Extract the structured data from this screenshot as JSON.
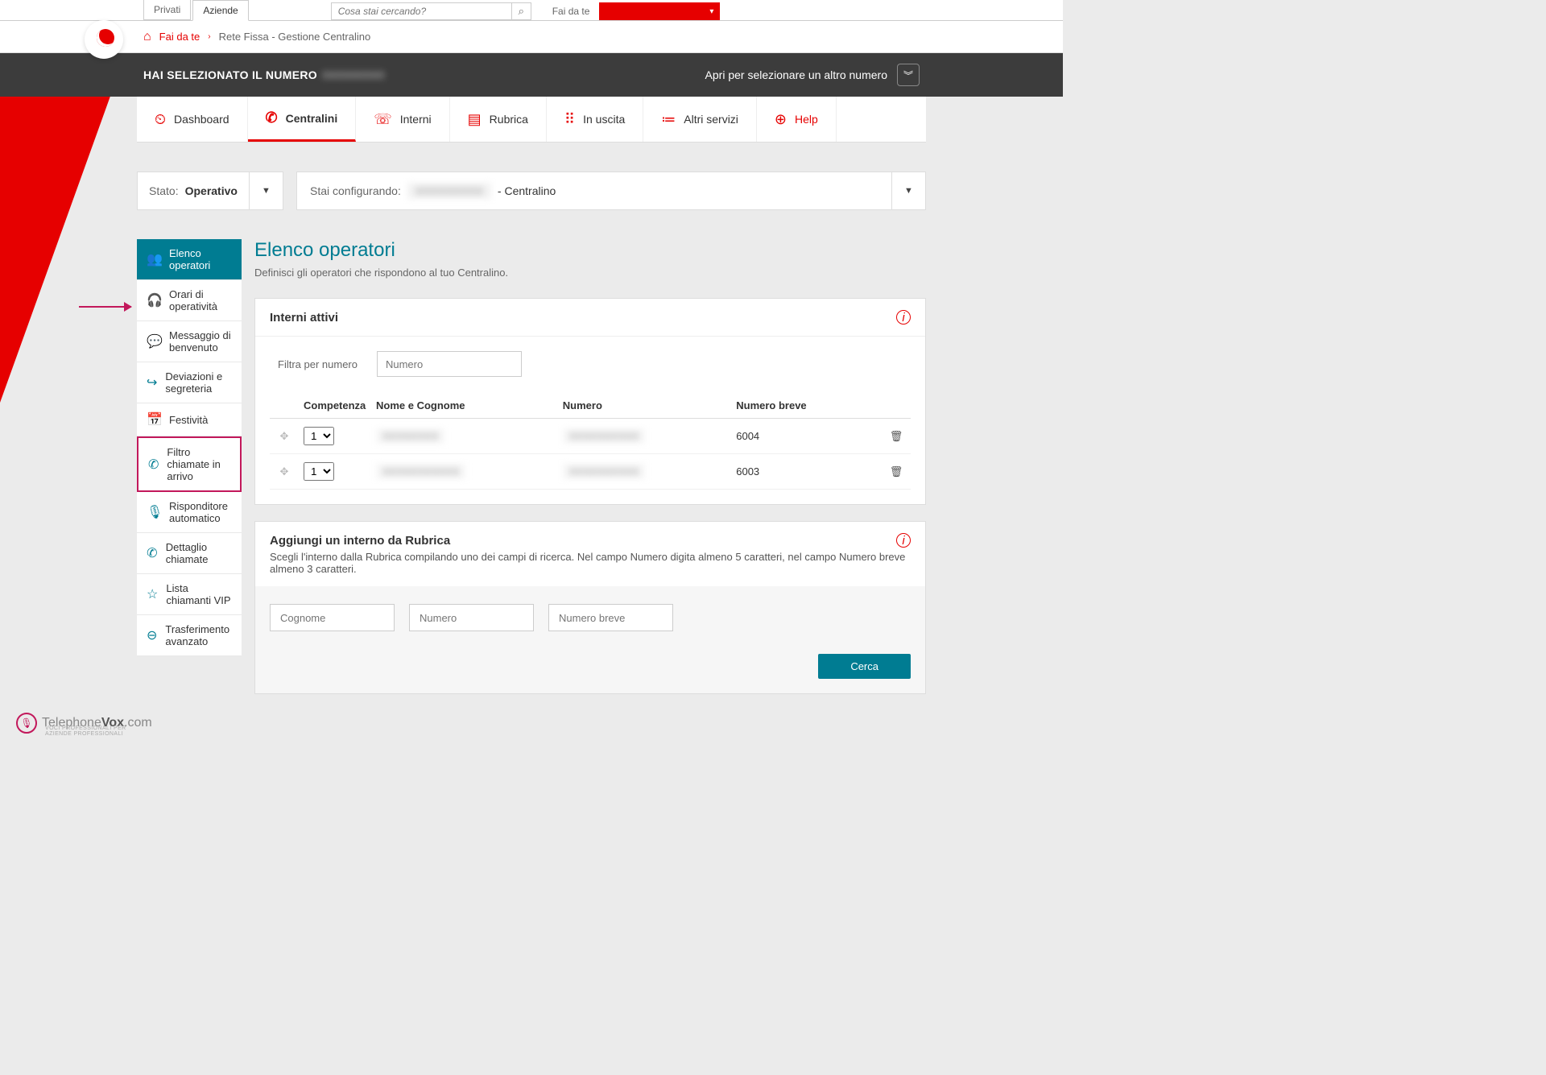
{
  "top": {
    "tab_privati": "Privati",
    "tab_aziende": "Aziende",
    "search_placeholder": "Cosa stai cercando?",
    "faidate_label": "Fai da te"
  },
  "breadcrumb": {
    "home_text": "Fai da te",
    "current": "Rete Fissa - Gestione Centralino"
  },
  "darkbar": {
    "label": "HAI SELEZIONATO IL NUMERO",
    "blur_number": "0000000000",
    "open_label": "Apri per selezionare un altro numero"
  },
  "nav": {
    "dashboard": "Dashboard",
    "centralini": "Centralini",
    "interni": "Interni",
    "rubrica": "Rubrica",
    "uscita": "In uscita",
    "altri": "Altri servizi",
    "help": "Help"
  },
  "status": {
    "stato": "Stato:",
    "op": "Operativo",
    "config_label": "Stai configurando:",
    "config_blur": "XXXXXXXXX",
    "config_suffix": "- Centralino"
  },
  "sidebar": {
    "items": [
      {
        "label": "Elenco operatori"
      },
      {
        "label": "Orari di operatività"
      },
      {
        "label": "Messaggio di benvenuto"
      },
      {
        "label": "Deviazioni e segreteria"
      },
      {
        "label": "Festività"
      },
      {
        "label": "Filtro chiamate in arrivo"
      },
      {
        "label": "Risponditore automatico"
      },
      {
        "label": "Dettaglio chiamate"
      },
      {
        "label": "Lista chiamanti VIP"
      },
      {
        "label": "Trasferimento avanzato"
      }
    ]
  },
  "main": {
    "title": "Elenco operatori",
    "subtitle": "Definisci gli operatori che rispondono al tuo Centralino."
  },
  "interni": {
    "head": "Interni attivi",
    "filter_label": "Filtra per numero",
    "filter_placeholder": "Numero",
    "cols": {
      "comp": "Competenza",
      "nome": "Nome e Cognome",
      "numero": "Numero",
      "breve": "Numero breve"
    },
    "rows": [
      {
        "comp": "1",
        "nome": "XXXXXXXX",
        "numero": "XXXXXXXXXX",
        "breve": "6004"
      },
      {
        "comp": "1",
        "nome": "XXXXXXXXXXX",
        "numero": "XXXXXXXXXX",
        "breve": "6003"
      }
    ]
  },
  "add": {
    "head": "Aggiungi un interno da Rubrica",
    "desc": "Scegli l'interno dalla Rubrica compilando uno dei campi di ricerca. Nel campo Numero digita almeno 5 caratteri, nel campo Numero breve almeno 3 caratteri.",
    "cognome_ph": "Cognome",
    "numero_ph": "Numero",
    "breve_ph": "Numero breve",
    "cerca": "Cerca"
  },
  "footer": {
    "brand1": "Telephone",
    "brand2": "Vox",
    "brand3": ".com",
    "sub": "VOCI PROFESSIONALI PER AZIENDE PROFESSIONALI"
  }
}
